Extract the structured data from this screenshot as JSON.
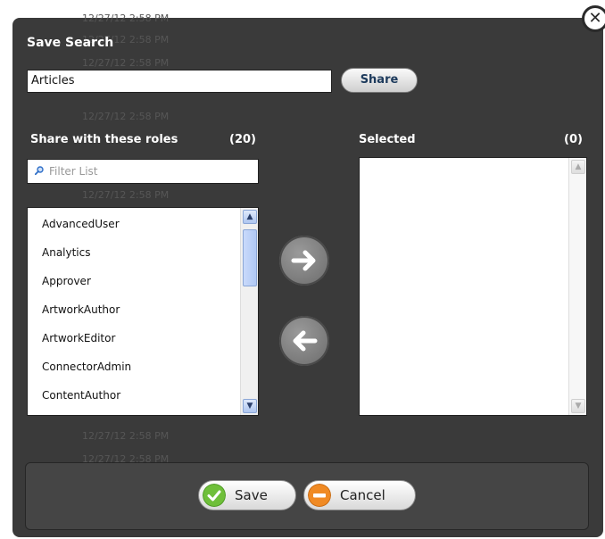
{
  "dialog": {
    "title": "Save Search",
    "search_name_value": "Articles",
    "share_label": "Share",
    "roles_label": "Share with these roles",
    "roles_count": "(20)",
    "filter_placeholder": "Filter List",
    "roles": [
      "AdvancedUser",
      "Analytics",
      "Approver",
      "ArtworkAuthor",
      "ArtworkEditor",
      "ConnectorAdmin",
      "ContentAuthor"
    ],
    "selected_label": "Selected",
    "selected_count": "(0)",
    "save_label": "Save",
    "cancel_label": "Cancel"
  },
  "background_timestamp": "12/27/12 2:58 PM",
  "colors": {
    "dialog_bg": "#3a3a3a",
    "save_icon": "#6fbf3a",
    "cancel_icon": "#f08a24"
  },
  "icons": {
    "close": "close-icon",
    "filter": "search-icon",
    "move_right": "arrow-right-icon",
    "move_left": "arrow-left-icon",
    "save": "checkmark-icon",
    "cancel": "minus-icon"
  }
}
